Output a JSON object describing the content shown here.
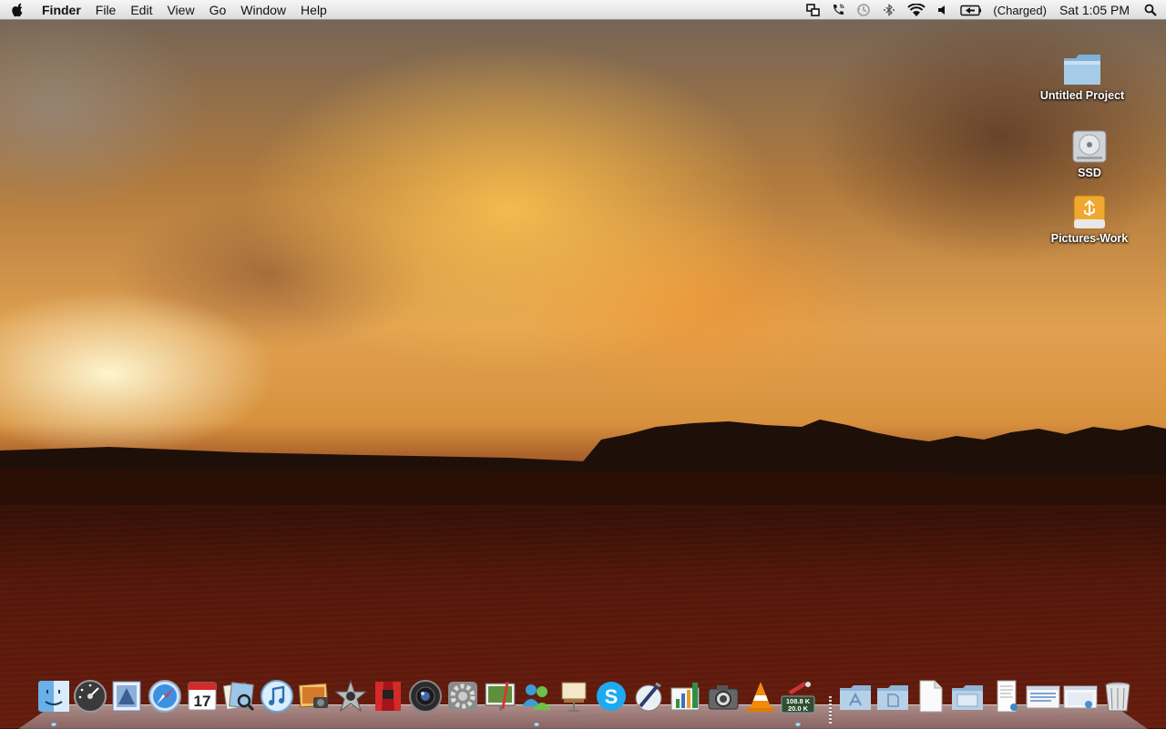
{
  "menubar": {
    "apple_icon": "apple-logo-icon",
    "app_name": "Finder",
    "menus": [
      "File",
      "Edit",
      "View",
      "Go",
      "Window",
      "Help"
    ],
    "status_icons": [
      "spaces-icon",
      "phone-icon",
      "time-machine-icon",
      "bluetooth-icon",
      "wifi-icon",
      "volume-icon",
      "battery-icon"
    ],
    "battery_text": "(Charged)",
    "clock": "Sat 1:05 PM",
    "search_icon": "spotlight-search-icon"
  },
  "desktop": {
    "icons": [
      {
        "label": "Untitled Project",
        "icon": "folder-icon"
      },
      {
        "label": "SSD",
        "icon": "hard-drive-icon"
      },
      {
        "label": "Pictures-Work",
        "icon": "usb-drive-icon"
      }
    ]
  },
  "dock": {
    "apps": [
      {
        "name": "finder",
        "running": true
      },
      {
        "name": "dashboard",
        "running": false
      },
      {
        "name": "mail",
        "running": false
      },
      {
        "name": "safari",
        "running": false
      },
      {
        "name": "ical",
        "running": false,
        "day": "17"
      },
      {
        "name": "preview",
        "running": false
      },
      {
        "name": "itunes",
        "running": false
      },
      {
        "name": "iphoto",
        "running": false
      },
      {
        "name": "imovie",
        "running": false
      },
      {
        "name": "photo-booth",
        "running": false
      },
      {
        "name": "aperture",
        "running": false
      },
      {
        "name": "system-preferences",
        "running": false
      },
      {
        "name": "keynote-screen",
        "running": false
      },
      {
        "name": "messenger",
        "running": true
      },
      {
        "name": "presentation",
        "running": false
      },
      {
        "name": "skype",
        "running": false
      },
      {
        "name": "pages",
        "running": false
      },
      {
        "name": "numbers",
        "running": false
      },
      {
        "name": "image-capture",
        "running": false
      },
      {
        "name": "vlc",
        "running": false
      },
      {
        "name": "network-meter",
        "running": true,
        "up": "108.8 K",
        "down": "20.0 K"
      }
    ],
    "stacks": [
      {
        "name": "applications-folder"
      },
      {
        "name": "documents-folder"
      },
      {
        "name": "document-file"
      },
      {
        "name": "downloads-folder"
      },
      {
        "name": "text-document"
      },
      {
        "name": "mail-window"
      },
      {
        "name": "preview-window"
      },
      {
        "name": "trash"
      }
    ]
  }
}
